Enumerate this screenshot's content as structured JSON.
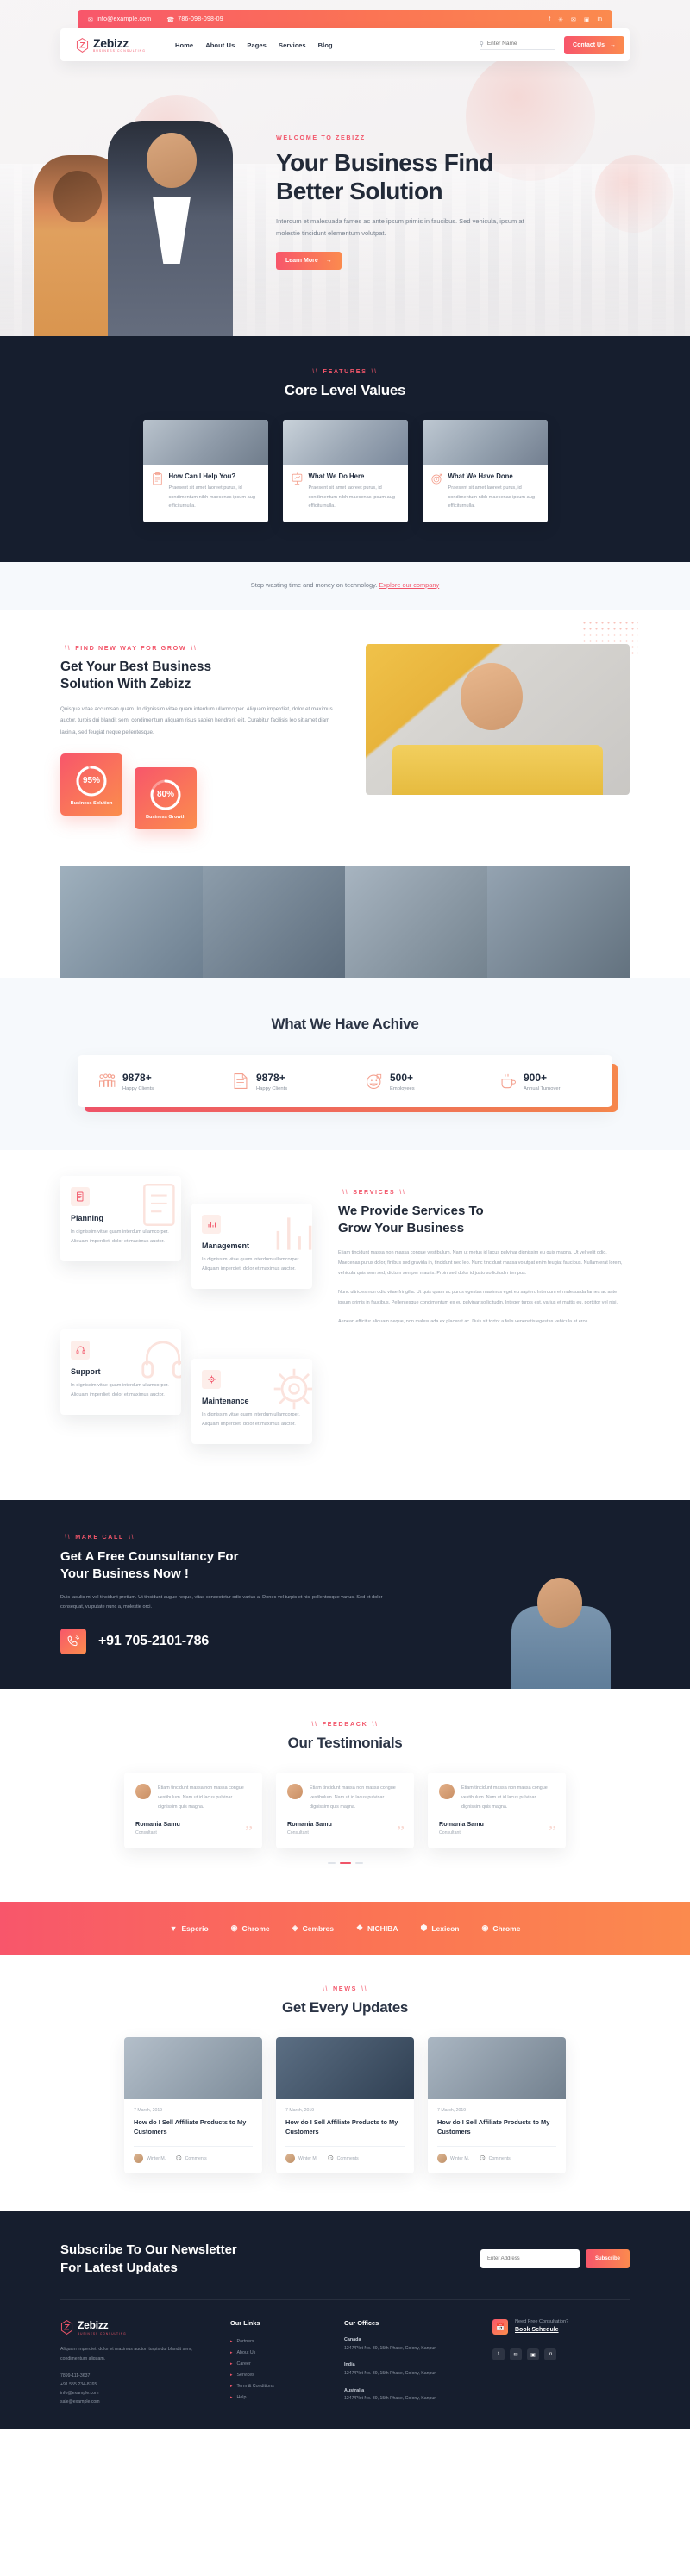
{
  "topbar": {
    "email": "info@example.com",
    "phone": "786-098-098-09",
    "socials": [
      "facebook-icon",
      "twitter-icon",
      "behance-icon",
      "instagram-icon",
      "linkedin-icon"
    ],
    "social_glyphs": [
      "f",
      "✉",
      "❋",
      "▣",
      "in"
    ]
  },
  "nav": {
    "brand": "Zebizz",
    "brand_sub": "BUSINESS CONSULTING",
    "links": [
      "Home",
      "About Us",
      "Pages",
      "Services",
      "Blog"
    ],
    "search_placeholder": "Enter Name",
    "contact_label": "Contact Us"
  },
  "hero": {
    "eyebrow": "WELCOME TO ZEBIZZ",
    "title_line1": "Your Business Find",
    "title_line2": "Better Solution",
    "desc": "Interdum et malesuada fames ac ante ipsum primis in faucibus. Sed vehicula, ipsum at molestie tincidunt elementum volutpat.",
    "cta": "Learn More"
  },
  "features": {
    "eyebrow": "FEATURES",
    "title": "Core Level Values",
    "cards": [
      {
        "icon": "clipboard-icon",
        "title": "How Can I Help You?",
        "text": "Praesent sit amet laoreet purus, id condimentum nibh maecenas ipsum aug efficiturnulla."
      },
      {
        "icon": "presentation-icon",
        "title": "What We Do Here",
        "text": "Praesent sit amet laoreet purus, id condimentum nibh maecenas ipsum aug efficiturnulla."
      },
      {
        "icon": "target-icon",
        "title": "What We Have Done",
        "text": "Praesent sit amet laoreet purus, id condimentum nibh maecenas ipsum aug efficiturnulla."
      }
    ]
  },
  "tech_strip": {
    "text": "Stop wasting time and money on technology.",
    "link": "Explore our company"
  },
  "solution": {
    "eyebrow": "FIND NEW WAY FOR GROW",
    "title_line1": "Get Your Best Business",
    "title_line2": "Solution With Zebizz",
    "desc": "Quisque vitae accumsan quam. In dignissim vitae quam interdum ullamcorper. Aliquam imperdiet, dolor et maximus auctor, turpis dui blandit sem, condimentum aliquam risus sapien hendrerit elit. Curabitur facilisis leo sit amet diam lacinia, sed feugiat neque pellentesque.",
    "badges": [
      {
        "percent": "95%",
        "value": 95,
        "label": "Business Solution"
      },
      {
        "percent": "80%",
        "value": 80,
        "label": "Business Growth"
      }
    ]
  },
  "achieve": {
    "title": "What We Have Achive",
    "counters": [
      {
        "icon": "people-icon",
        "number": "9878+",
        "label": "Happy Clients"
      },
      {
        "icon": "document-icon",
        "number": "9878+",
        "label": "Happy Clients"
      },
      {
        "icon": "smile-icon",
        "number": "500+",
        "label": "Employees"
      },
      {
        "icon": "coffee-icon",
        "number": "900+",
        "label": "Annual Turnover"
      }
    ]
  },
  "services": {
    "eyebrow": "SERVICES",
    "title_line1": "We Provide Services To",
    "title_line2": "Grow Your Business",
    "para1": "Etiam tincidunt massa non massa congue vestibulum. Nam ut metus id lacus pulvinar dignissim eu quis magna. Ut vel velit odio. Maecenas purus dolor, finibus sed gravida in, tincidunt nec leo. Nunc tincidunt massa volutpat enim feugiat faucibus. Nullam erat lorem, vehicula quis sem sed, dictum semper mauris. Proin sed dolor id justo sollicitudin tempus.",
    "para2": "Nunc ultricies non odio vitae fringilla. Ut quis quam ac purus egestas maximus eget eu sapien. Interdum et malesuada fames ac ante ipsum primis in faucibus. Pellentesque condimentum ex eu pulvinar sollicitudin. Integer turpis est, varius et mattis eu, porttitor vel nisi.",
    "para3": "Aenean efficitur aliquam neque, non malesuada ex placerat ac. Duis sit tortor a felis venenatis egestas vehicula at eros.",
    "cards": [
      {
        "icon": "planning-icon",
        "title": "Planning",
        "text": "In dignissim vitae quam interdum ullamcorper. Aliquam imperdiet, dolor et maximus auctor."
      },
      {
        "icon": "chart-icon",
        "title": "Management",
        "text": "In dignissim vitae quam interdum ullamcorper. Aliquam imperdiet, dolor et maximus auctor."
      },
      {
        "icon": "headset-icon",
        "title": "Support",
        "text": "In dignissim vitae quam interdum ullamcorper. Aliquam imperdiet, dolor et maximus auctor."
      },
      {
        "icon": "gear-icon",
        "title": "Maintenance",
        "text": "In dignissim vitae quam interdum ullamcorper. Aliquam imperdiet, dolor et maximus auctor."
      }
    ]
  },
  "consult": {
    "eyebrow": "MAKE CALL",
    "title_line1": "Get A Free Counsultancy For",
    "title_line2": "Your Business Now !",
    "desc": "Duis iaculis mi vel tincidunt pretium. Ut tincidunt augue neque, vitae consectetur odio varius a. Donec vel turpis et nisi pellentesque varius. Sed et dolor consequat, vulputate nunc a, molestie orci.",
    "phone": "+91 705-2101-786",
    "phone_icon": "phone-call-icon"
  },
  "testimonials": {
    "eyebrow": "FEEDBACK",
    "title": "Our Testimonials",
    "items": [
      {
        "quote": "Etiam tincidunt massa non massa congue vestibulum. Nam ut id lacus pulvinar dignissim quis magna.",
        "name": "Romania Samu",
        "role": "Consultant"
      },
      {
        "quote": "Etiam tincidunt massa non massa congue vestibulum. Nam ut id lacus pulvinar dignissim quis magna.",
        "name": "Romania Samu",
        "role": "Consultant"
      },
      {
        "quote": "Etiam tincidunt massa non massa congue vestibulum. Nam ut id lacus pulvinar dignissim quis magna.",
        "name": "Romania Samu",
        "role": "Consultant"
      }
    ]
  },
  "brands": [
    {
      "glyph": "▼",
      "name": "Esperio"
    },
    {
      "glyph": "◉",
      "name": "Chrome"
    },
    {
      "glyph": "◈",
      "name": "Cembres"
    },
    {
      "glyph": "❖",
      "name": "NICHIBA"
    },
    {
      "glyph": "⬢",
      "name": "Lexicon"
    },
    {
      "glyph": "◉",
      "name": "Chrome"
    }
  ],
  "blog": {
    "eyebrow": "NEWS",
    "title": "Get Every Updates",
    "posts": [
      {
        "date": "7 March, 2019",
        "title": "How do I Sell Affiliate Products to My Customers",
        "author": "Winter M.",
        "comments": "Comments"
      },
      {
        "date": "7 March, 2019",
        "title": "How do I Sell Affiliate Products to My Customers",
        "author": "Winter M.",
        "comments": "Comments"
      },
      {
        "date": "7 March, 2019",
        "title": "How do I Sell Affiliate Products to My Customers",
        "author": "Winter M.",
        "comments": "Comments"
      }
    ]
  },
  "footer": {
    "news_line1": "Subscribe To Our Newsletter",
    "news_line2": "For Latest Updates",
    "news_placeholder": "Enter Address",
    "news_button": "Subscribe",
    "brand": "Zebizz",
    "brand_sub": "BUSINESS CONSULTING",
    "about": "Aliquam imperdiet, dolor et maximus auctor, turpis dui blandit sem, condimentum aliquam.",
    "contact": [
      "7899-111-3637",
      "+91 555 234-8765",
      "info@example.com",
      "sale@example.com"
    ],
    "links_title": "Our Links",
    "links": [
      "Partners",
      "About Us",
      "Career",
      "Services",
      "Term & Conditions",
      "Help"
    ],
    "offices_title": "Our Offices",
    "offices": [
      {
        "name": "Canada",
        "address": "1247/Plot No. 39, 15th Phase, Colony, Kanpur"
      },
      {
        "name": "India",
        "address": "1247/Plot No. 39, 15th Phase, Colony, Kanpur"
      },
      {
        "name": "Australia",
        "address": "1247/Plot No. 39, 15th Phase, Colony, Kanpur"
      }
    ],
    "cta_text": "Need Free Consultation?",
    "cta_link": "Book Schedule",
    "socials": [
      "f",
      "✉",
      "▣",
      "in"
    ]
  },
  "colors": {
    "accent_start": "#f8566b",
    "accent_end": "#fb8a4e",
    "dark": "#161e2e",
    "light_bg": "#f6f9fc"
  }
}
